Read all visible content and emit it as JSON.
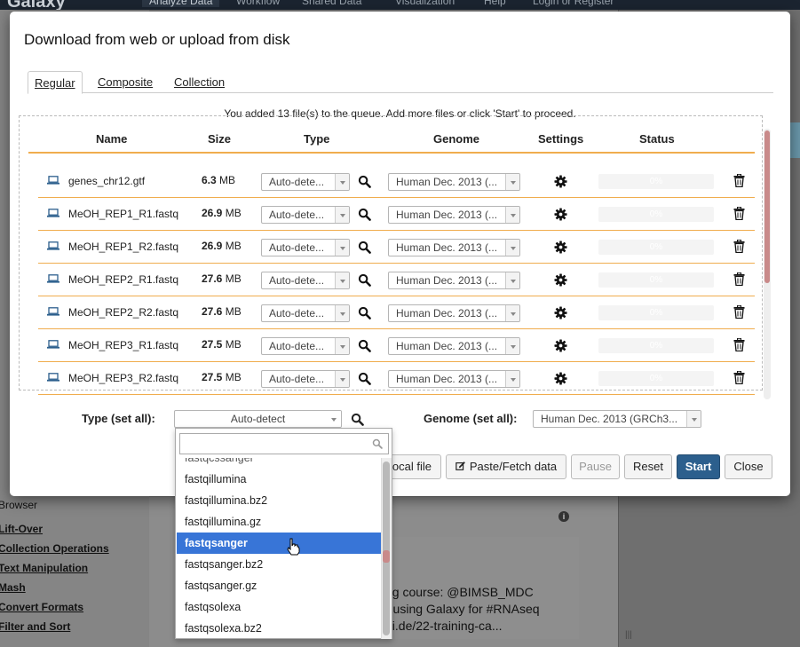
{
  "background": {
    "brand": "Galaxy",
    "nav": [
      "Analyze Data",
      "Workflow",
      "Shared Data",
      "Visualization",
      "Help",
      "Login or Register"
    ],
    "tools": [
      "Lift-Over",
      "Collection Operations",
      "Text Manipulation",
      "Mash",
      "Convert Formats",
      "Filter and Sort",
      "Browser"
    ],
    "tweet_lines": [
      "ng course: @BIMSB_MDC",
      "- using Galaxy for #RNAseq",
      "bi.de/22-training-ca..."
    ]
  },
  "modal": {
    "title": "Download from web or upload from disk",
    "tabs": [
      "Regular",
      "Composite",
      "Collection"
    ],
    "queue_message": "You added 13 file(s) to the queue. Add more files or click 'Start' to proceed.",
    "columns": {
      "name": "Name",
      "size": "Size",
      "type": "Type",
      "genome": "Genome",
      "settings": "Settings",
      "status": "Status"
    },
    "files": [
      {
        "name": "genes_chr12.gtf",
        "size_value": "6.3",
        "size_unit": "MB",
        "type": "Auto-dete...",
        "genome": "Human Dec. 2013 (...",
        "status": "0%"
      },
      {
        "name": "MeOH_REP1_R1.fastq",
        "size_value": "26.9",
        "size_unit": "MB",
        "type": "Auto-dete...",
        "genome": "Human Dec. 2013 (...",
        "status": "0%"
      },
      {
        "name": "MeOH_REP1_R2.fastq",
        "size_value": "26.9",
        "size_unit": "MB",
        "type": "Auto-dete...",
        "genome": "Human Dec. 2013 (...",
        "status": "0%"
      },
      {
        "name": "MeOH_REP2_R1.fastq",
        "size_value": "27.6",
        "size_unit": "MB",
        "type": "Auto-dete...",
        "genome": "Human Dec. 2013 (...",
        "status": "0%"
      },
      {
        "name": "MeOH_REP2_R2.fastq",
        "size_value": "27.6",
        "size_unit": "MB",
        "type": "Auto-dete...",
        "genome": "Human Dec. 2013 (...",
        "status": "0%"
      },
      {
        "name": "MeOH_REP3_R1.fastq",
        "size_value": "27.5",
        "size_unit": "MB",
        "type": "Auto-dete...",
        "genome": "Human Dec. 2013 (...",
        "status": "0%"
      },
      {
        "name": "MeOH_REP3_R2.fastq",
        "size_value": "27.5",
        "size_unit": "MB",
        "type": "Auto-dete...",
        "genome": "Human Dec. 2013 (...",
        "status": "0%"
      }
    ],
    "set_all": {
      "type_label": "Type (set all):",
      "type_value": "Auto-detect",
      "genome_label": "Genome (set all):",
      "genome_value": "Human Dec. 2013 (GRCh3..."
    },
    "buttons": {
      "local_file": "ocal file",
      "paste_fetch": "Paste/Fetch data",
      "pause": "Pause",
      "reset": "Reset",
      "start": "Start",
      "close": "Close"
    }
  },
  "dropdown": {
    "search_value": "",
    "options": [
      "fastqillumina",
      "fastqillumina.bz2",
      "fastqillumina.gz",
      "fastqsanger",
      "fastqsanger.bz2",
      "fastqsanger.gz",
      "fastqsolexa",
      "fastqsolexa.bz2"
    ],
    "highlighted": "fastqsanger"
  },
  "colors": {
    "accent": "#f0ad4e",
    "primary": "#2c5f8d",
    "highlight": "#3875d7"
  }
}
